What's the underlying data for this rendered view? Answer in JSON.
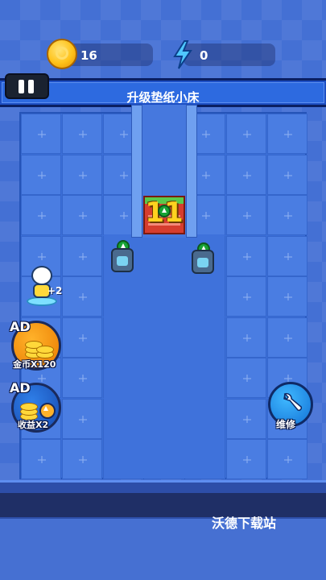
{
  "resources": {
    "coins": "16",
    "energy": "0"
  },
  "title": "升级垫纸小床",
  "bed": {
    "level": "11"
  },
  "character": {
    "bonus": "+2"
  },
  "ads": {
    "coins": {
      "badge": "AD",
      "label": "金币X120"
    },
    "income": {
      "badge": "AD",
      "label": "收益X2"
    }
  },
  "repair": {
    "label": "维修"
  },
  "watermark": "沃德下载站",
  "colors": {
    "background": "#4470d4",
    "board": "#3b6fd8",
    "title_bar": "#2d6ae0",
    "bed": "#d63d2e",
    "level_text": "#ffd21f",
    "coin_button": "#ffb22a",
    "income_button": "#2f7fe8",
    "repair_button": "#3fb8ff"
  },
  "icons": [
    "coin-icon",
    "lightning-icon",
    "pause-icon",
    "upgrade-arrow-icon",
    "wrench-icon"
  ]
}
